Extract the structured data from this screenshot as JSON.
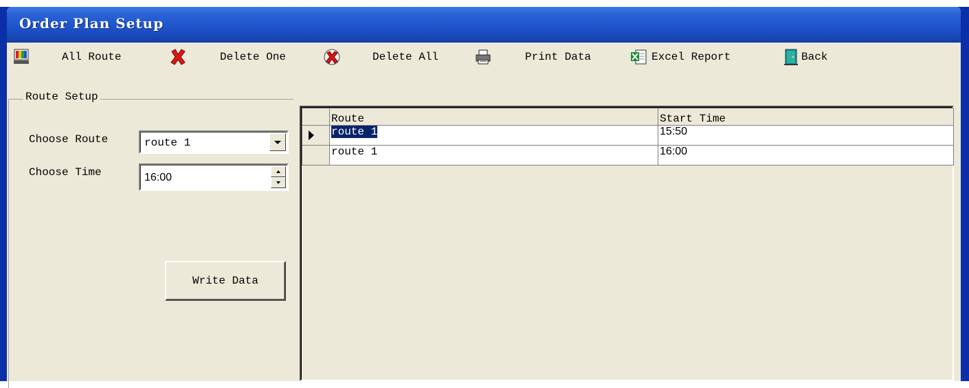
{
  "window": {
    "title": "Order Plan Setup"
  },
  "toolbar": {
    "buttons": [
      {
        "label": "All Route",
        "icon": "all-route-icon"
      },
      {
        "label": "Delete One",
        "icon": "red-x-icon"
      },
      {
        "label": "Delete All",
        "icon": "delete-all-icon"
      },
      {
        "label": "Print Data",
        "icon": "printer-icon"
      },
      {
        "label": "Excel Report",
        "icon": "excel-icon"
      },
      {
        "label": "Back",
        "icon": "exit-door-icon"
      }
    ]
  },
  "route_setup": {
    "title": "Route Setup",
    "choose_route_label": "Choose Route",
    "choose_route_value": "route 1",
    "choose_time_label": "Choose Time",
    "choose_time_value": "16:00",
    "write_button": "Write Data"
  },
  "grid": {
    "columns": [
      "Route",
      "Start Time"
    ],
    "rows": [
      {
        "route": "route 1",
        "start_time": "15:50",
        "current": true
      },
      {
        "route": "route 1",
        "start_time": "16:00",
        "current": false
      }
    ]
  },
  "colors": {
    "title_bar": "#1f54cc",
    "window_frame": "#0a2fa8",
    "client_bg": "#ece9d8",
    "selection": "#0a246a"
  }
}
